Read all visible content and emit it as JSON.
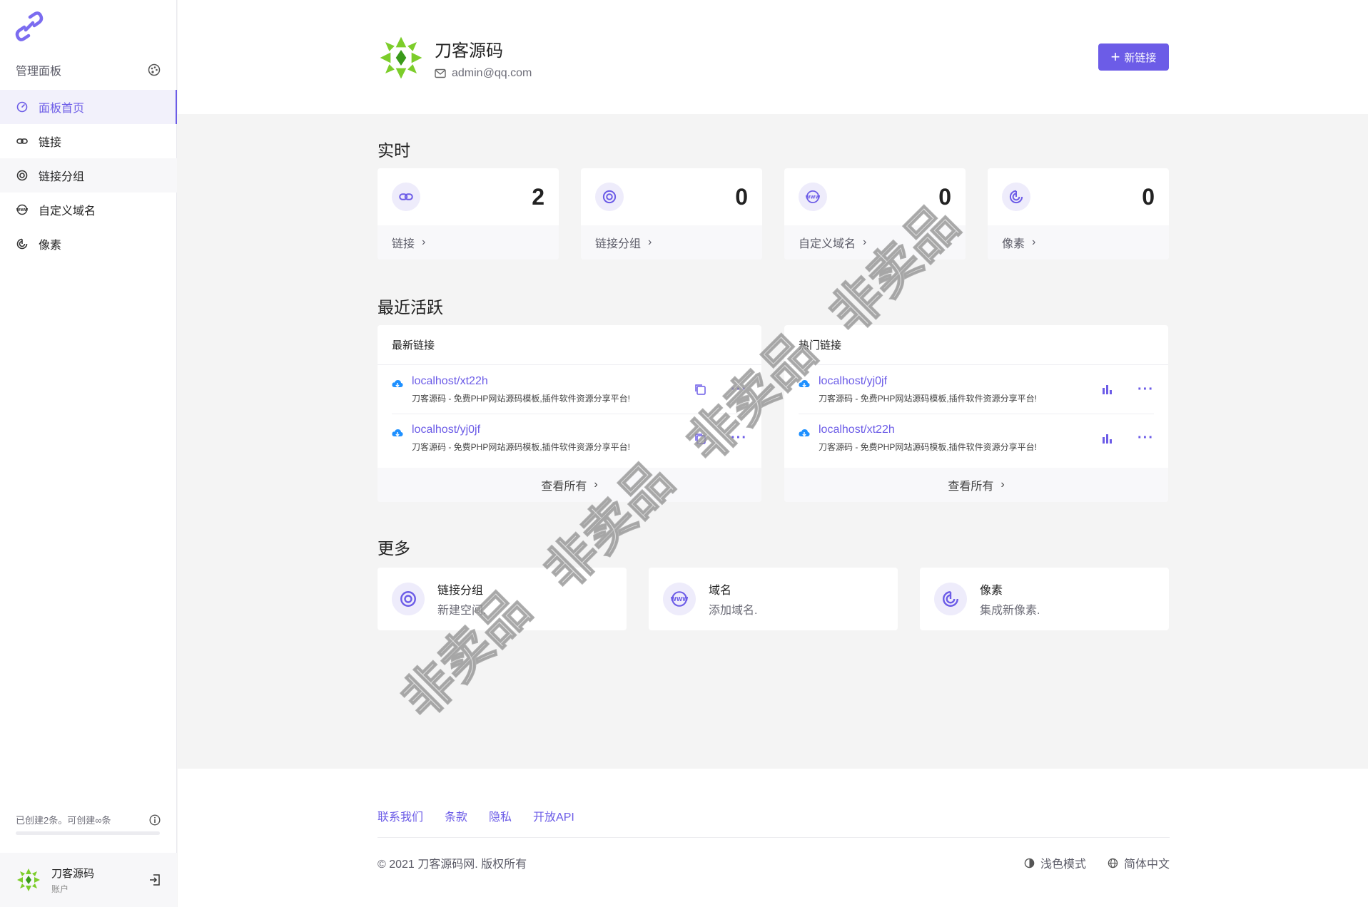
{
  "sidebar": {
    "panel_title": "管理面板",
    "items": [
      {
        "label": "面板首页",
        "icon": "dashboard-icon"
      },
      {
        "label": "链接",
        "icon": "link-icon"
      },
      {
        "label": "链接分组",
        "icon": "target-icon"
      },
      {
        "label": "自定义域名",
        "icon": "www-icon"
      },
      {
        "label": "像素",
        "icon": "pixel-icon"
      }
    ],
    "quota_text": "已创建2条。可创建∞条",
    "quota_fraction": 0,
    "account_name": "刀客源码",
    "account_role": "账户"
  },
  "header": {
    "site_name": "刀客源码",
    "email": "admin@qq.com",
    "new_link_button": "新链接"
  },
  "realtime": {
    "title": "实时",
    "cards": [
      {
        "label": "链接",
        "value": "2",
        "icon": "link-icon"
      },
      {
        "label": "链接分组",
        "value": "0",
        "icon": "target-icon"
      },
      {
        "label": "自定义域名",
        "value": "0",
        "icon": "www-icon"
      },
      {
        "label": "像素",
        "value": "0",
        "icon": "pixel-icon"
      }
    ]
  },
  "recent": {
    "title": "最近活跃",
    "latest": {
      "title": "最新链接",
      "rows": [
        {
          "link": "localhost/xt22h",
          "desc": "刀客源码 - 免费PHP网站源码模板,插件软件资源分享平台!"
        },
        {
          "link": "localhost/yj0jf",
          "desc": "刀客源码 - 免费PHP网站源码模板,插件软件资源分享平台!"
        }
      ],
      "view_all": "查看所有"
    },
    "popular": {
      "title": "热门链接",
      "rows": [
        {
          "link": "localhost/yj0jf",
          "desc": "刀客源码 - 免费PHP网站源码模板,插件软件资源分享平台!"
        },
        {
          "link": "localhost/xt22h",
          "desc": "刀客源码 - 免费PHP网站源码模板,插件软件资源分享平台!"
        }
      ],
      "view_all": "查看所有"
    }
  },
  "more": {
    "title": "更多",
    "cards": [
      {
        "title": "链接分组",
        "subtitle": "新建空间.",
        "icon": "target-icon"
      },
      {
        "title": "域名",
        "subtitle": "添加域名.",
        "icon": "www-icon"
      },
      {
        "title": "像素",
        "subtitle": "集成新像素.",
        "icon": "pixel-icon"
      }
    ]
  },
  "footer": {
    "links": [
      "联系我们",
      "条款",
      "隐私",
      "开放API"
    ],
    "copyright": "© 2021 刀客源码网. 版权所有",
    "theme_toggle": "浅色模式",
    "language": "简体中文"
  },
  "watermark": "非卖品",
  "colors": {
    "accent": "#6c5ce7",
    "download": "#1e90ff",
    "logo_green": "#7ccd2a"
  }
}
